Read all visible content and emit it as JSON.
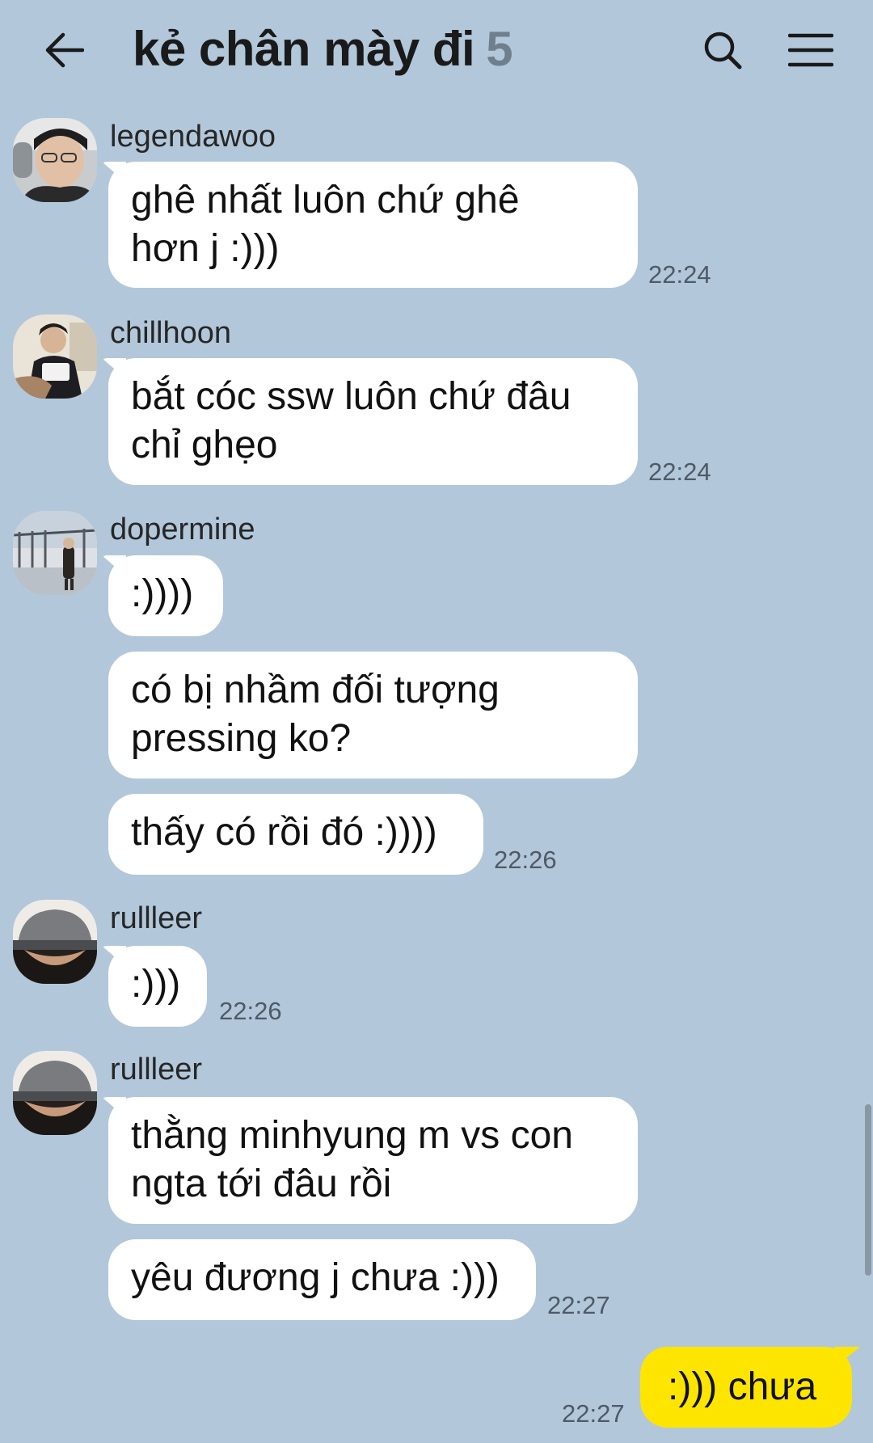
{
  "header": {
    "title": "kẻ chân mày đi",
    "member_count": "5",
    "back_icon": "arrow-left-icon",
    "search_icon": "search-icon",
    "menu_icon": "hamburger-menu-icon"
  },
  "colors": {
    "background": "#b2c7da",
    "incoming_bubble": "#ffffff",
    "outgoing_bubble": "#fee500"
  },
  "messages": [
    {
      "sender": "legendawoo",
      "lines": [
        "ghê nhất luôn chứ ghê",
        "hơn j :)))"
      ],
      "time": "22:24"
    },
    {
      "sender": "chillhoon",
      "lines": [
        "bắt cóc ssw luôn chứ đâu",
        "chỉ ghẹo"
      ],
      "time": "22:24"
    },
    {
      "sender": "dopermine",
      "bubbles": [
        {
          "lines": [
            ":))))"
          ]
        },
        {
          "lines": [
            "có bị nhầm đối tượng",
            "pressing ko?"
          ]
        },
        {
          "lines": [
            "thấy có rồi đó :))))"
          ],
          "time": "22:26"
        }
      ]
    },
    {
      "sender": "rullleer",
      "lines": [
        ":)))"
      ],
      "time": "22:26"
    },
    {
      "sender": "rullleer",
      "bubbles": [
        {
          "lines": [
            "thằng minhyung m vs con",
            "ngta tới đâu rồi"
          ]
        },
        {
          "lines": [
            "yêu đương j chưa :)))"
          ],
          "time": "22:27"
        }
      ]
    },
    {
      "mine": true,
      "lines": [
        ":))) chưa"
      ],
      "time": "22:27"
    }
  ]
}
